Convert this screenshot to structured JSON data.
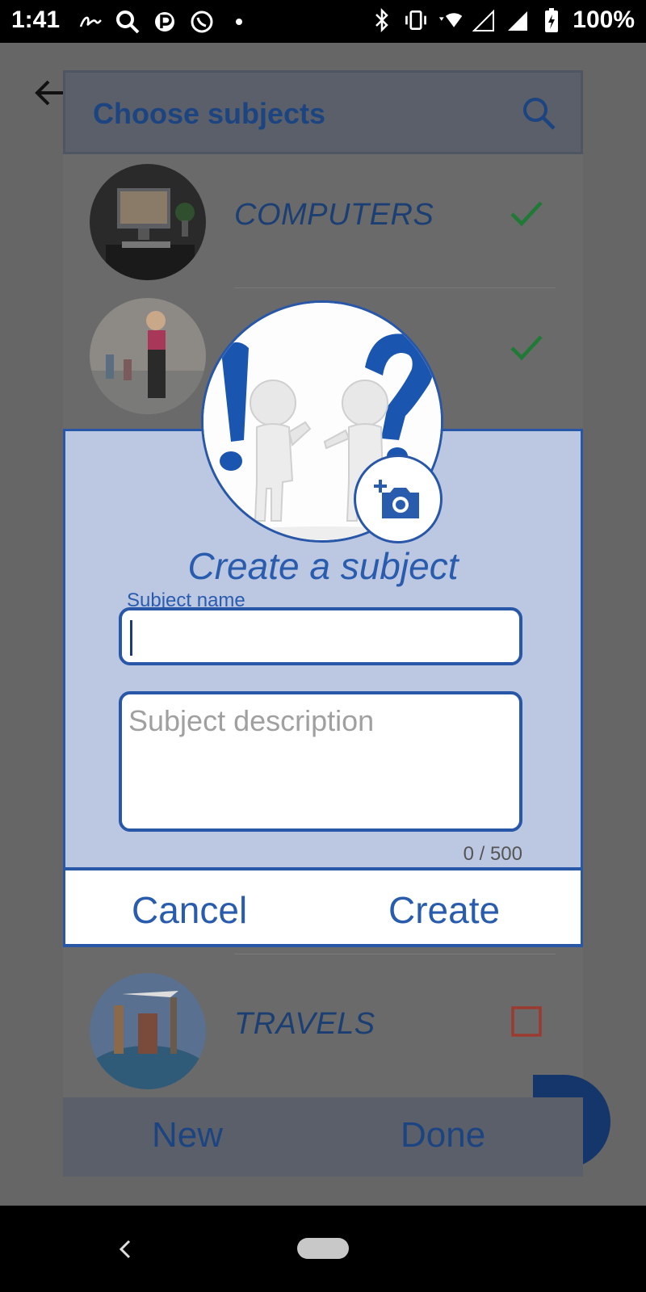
{
  "status_bar": {
    "time": "1:41",
    "battery": "100%"
  },
  "app_bar": {
    "title": "Choose subjects"
  },
  "subjects": [
    {
      "label": "COMPUTERS",
      "state": "checked"
    },
    {
      "label": "",
      "state": "checked"
    },
    {
      "label": "TRAVELS",
      "state": "unchecked"
    }
  ],
  "bottom_bar": {
    "new_label": "New",
    "done_label": "Done"
  },
  "dialog": {
    "title": "Create a subject",
    "name_label": "Subject name",
    "name_value": "",
    "description_placeholder": "Subject description",
    "counter": "0 / 500",
    "cancel_label": "Cancel",
    "create_label": "Create"
  },
  "colors": {
    "accent": "#2957a8",
    "dialog_bg": "#bcc7e2",
    "check_green": "#1e8a3a",
    "check_unchecked": "#b03a2e"
  }
}
